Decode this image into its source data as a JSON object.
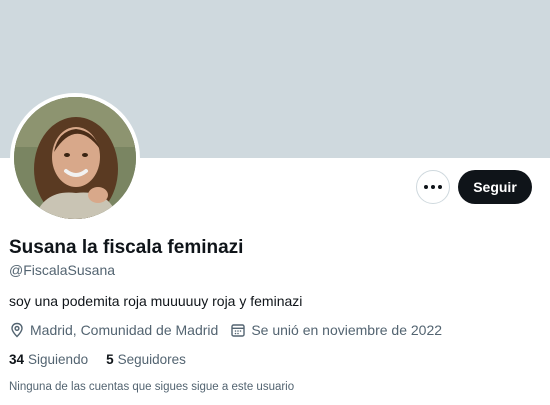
{
  "profile": {
    "display_name": "Susana la fiscala feminazi",
    "handle": "@FiscalaSusana",
    "bio": "soy una podemita roja muuuuuy roja y feminazi",
    "location": "Madrid, Comunidad de Madrid",
    "joined": "Se unió en noviembre de 2022"
  },
  "actions": {
    "follow_label": "Seguir"
  },
  "stats": {
    "following_count": "34",
    "following_label": "Siguiendo",
    "followers_count": "5",
    "followers_label": "Seguidores"
  },
  "followers_note": "Ninguna de las cuentas que sigues sigue a este usuario",
  "colors": {
    "banner": "#cfd9de",
    "primary_text": "#0f1419",
    "secondary_text": "#536471",
    "follow_button": "#0f1419"
  },
  "icons": {
    "location": "location-pin-icon",
    "joined": "calendar-icon",
    "more": "more-horizontal-icon"
  }
}
